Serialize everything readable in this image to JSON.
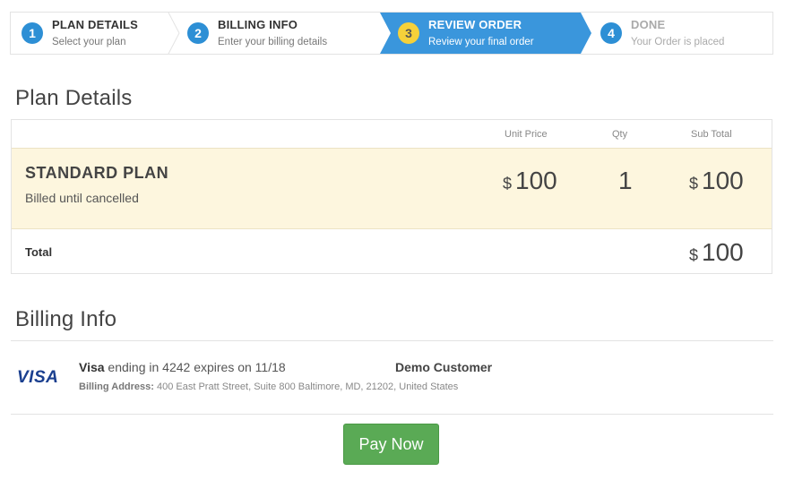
{
  "steps": [
    {
      "number": "1",
      "title": "PLAN DETAILS",
      "subtitle": "Select your plan"
    },
    {
      "number": "2",
      "title": "BILLING INFO",
      "subtitle": "Enter your billing details"
    },
    {
      "number": "3",
      "title": "REVIEW ORDER",
      "subtitle": "Review your final order"
    },
    {
      "number": "4",
      "title": "DONE",
      "subtitle": "Your Order is placed"
    }
  ],
  "active_step": "3",
  "colors": {
    "active_step": "#3a96dc",
    "step_number": "#2d8fd5",
    "highlight_row": "#fdf6de",
    "pay_button": "#5aaa55",
    "visa_blue": "#1a3f8f"
  },
  "plan_section": {
    "title": "Plan Details",
    "columns": {
      "unit_price": "Unit Price",
      "qty": "Qty",
      "sub_total": "Sub Total"
    },
    "plan": {
      "name": "STANDARD PLAN",
      "description": "Billed until cancelled",
      "currency": "$",
      "unit_price": "100",
      "qty": "1",
      "sub_total": "100"
    },
    "total": {
      "label": "Total",
      "currency": "$",
      "value": "100"
    }
  },
  "billing_section": {
    "title": "Billing Info",
    "card_logo_text": "VISA",
    "card_brand": "Visa",
    "card_details": " ending in 4242 expires on 11/18",
    "address_label": "Billing Address:",
    "address": " 400 East Pratt Street, Suite 800 Baltimore, MD, 21202, United States",
    "customer_name": "Demo Customer"
  },
  "pay_button_label": "Pay Now"
}
